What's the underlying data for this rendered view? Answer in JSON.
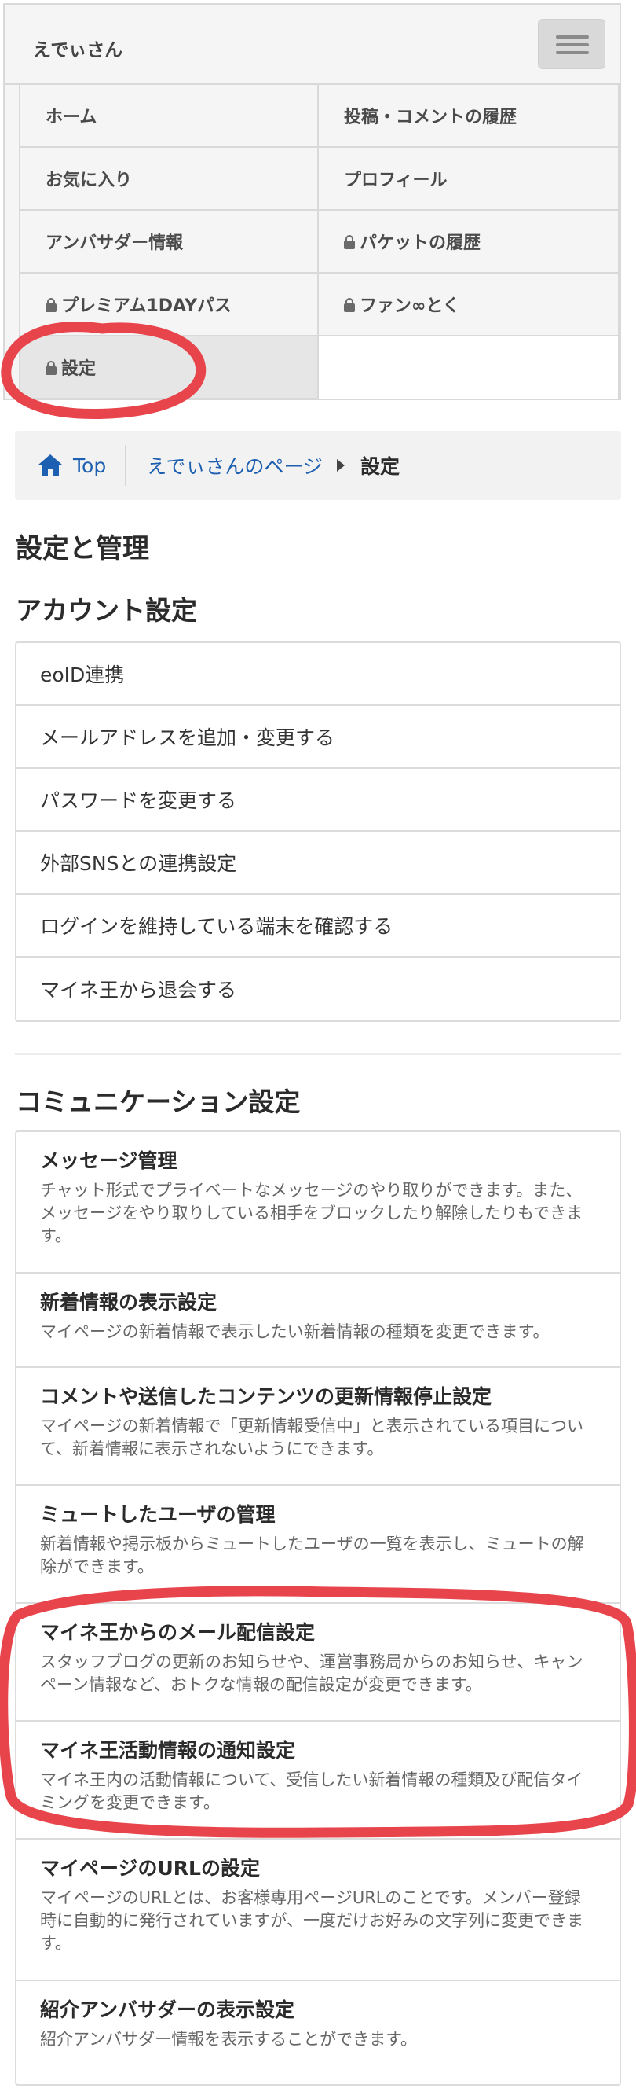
{
  "header": {
    "user_name": "えでぃさん",
    "menu_button_label": "menu"
  },
  "menu": {
    "items": [
      {
        "label": "ホーム",
        "locked": false
      },
      {
        "label": "投稿・コメントの履歴",
        "locked": false
      },
      {
        "label": "お気に入り",
        "locked": false
      },
      {
        "label": "プロフィール",
        "locked": false
      },
      {
        "label": "アンバサダー情報",
        "locked": false
      },
      {
        "label": "パケットの履歴",
        "locked": true
      },
      {
        "label": "プレミアム1DAYパス",
        "locked": true
      },
      {
        "label": "ファン∞とく",
        "locked": true
      },
      {
        "label": "設定",
        "locked": true,
        "active": true
      }
    ]
  },
  "breadcrumb": {
    "top": "Top",
    "page": "えでぃさんのページ",
    "current": "設定"
  },
  "page_title": "設定と管理",
  "account": {
    "heading": "アカウント設定",
    "items": [
      "eoID連携",
      "メールアドレスを追加・変更する",
      "パスワードを変更する",
      "外部SNSとの連携設定",
      "ログインを維持している端末を確認する",
      "マイネ王から退会する"
    ]
  },
  "communication": {
    "heading": "コミュニケーション設定",
    "items": [
      {
        "title": "メッセージ管理",
        "desc": "チャット形式でプライベートなメッセージのやり取りができます。また、メッセージをやり取りしている相手をブロックしたり解除したりもできます。"
      },
      {
        "title": "新着情報の表示設定",
        "desc": "マイページの新着情報で表示したい新着情報の種類を変更できます。"
      },
      {
        "title": "コメントや送信したコンテンツの更新情報停止設定",
        "desc": "マイページの新着情報で「更新情報受信中」と表示されている項目について、新着情報に表示されないようにできます。"
      },
      {
        "title": "ミュートしたユーザの管理",
        "desc": "新着情報や掲示板からミュートしたユーザの一覧を表示し、ミュートの解除ができます。"
      },
      {
        "title": "マイネ王からのメール配信設定",
        "desc": "スタッフブログの更新のお知らせや、運営事務局からのお知らせ、キャンペーン情報など、おトクな情報の配信設定が変更できます。"
      },
      {
        "title": "マイネ王活動情報の通知設定",
        "desc": "マイネ王内の活動情報について、受信したい新着情報の種類及び配信タイミングを変更できます。"
      },
      {
        "title": "マイページのURLの設定",
        "desc": "マイページのURLとは、お客様専用ページURLのことです。メンバー登録時に自動的に発行されていますが、一度だけお好みの文字列に変更できます。"
      },
      {
        "title": "紹介アンバサダーの表示設定",
        "desc": "紹介アンバサダー情報を表示することができます。"
      }
    ]
  },
  "colors": {
    "link": "#1d5fb0",
    "annotation": "#e8444b"
  }
}
